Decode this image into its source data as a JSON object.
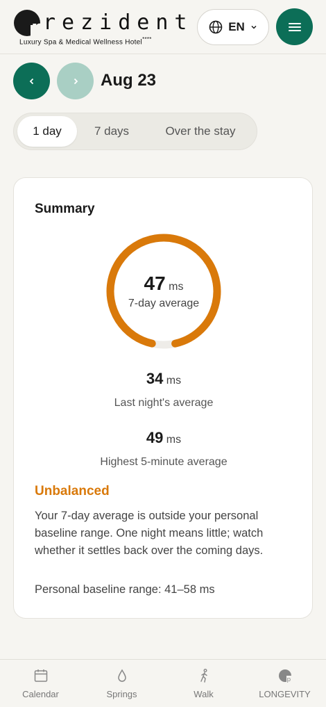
{
  "header": {
    "logo_word": "rezident",
    "logo_letter": "p",
    "logo_tagline": "Luxury Spa & Medical Wellness Hotel",
    "logo_stars": "****",
    "language": "EN"
  },
  "date_nav": {
    "date": "Aug 23"
  },
  "tabs": [
    {
      "label": "1 day",
      "active": true
    },
    {
      "label": "7 days",
      "active": false
    },
    {
      "label": "Over the stay",
      "active": false
    }
  ],
  "summary": {
    "title": "Summary",
    "gauge_value": "47",
    "gauge_unit": "ms",
    "gauge_caption": "7-day average",
    "gauge_fill_fraction": 0.93,
    "gauge_color": "#d9790a",
    "metrics": [
      {
        "value": "34",
        "unit": "ms",
        "label": "Last night's average"
      },
      {
        "value": "49",
        "unit": "ms",
        "label": "Highest 5-minute average"
      }
    ],
    "status": "Unbalanced",
    "description": "Your 7-day average is outside your personal baseline range. One night means little; watch whether it settles back over the coming days.",
    "baseline": "Personal baseline range: 41–58 ms"
  },
  "bottom_nav": [
    {
      "label": "Calendar",
      "icon": "calendar-icon"
    },
    {
      "label": "Springs",
      "icon": "drop-icon"
    },
    {
      "label": "Walk",
      "icon": "walk-icon"
    },
    {
      "label": "LONGEVITY",
      "icon": "longevity-logo-icon"
    }
  ],
  "colors": {
    "brand_green": "#0c6e57",
    "accent_orange": "#d9790a"
  }
}
